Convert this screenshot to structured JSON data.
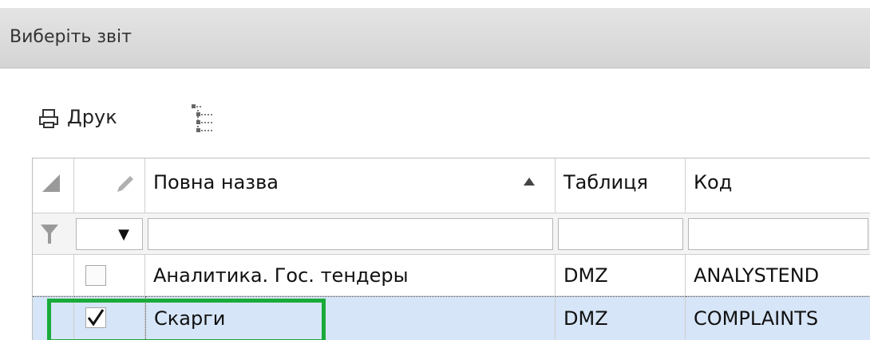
{
  "header": {
    "title": "Виберіть звіт"
  },
  "toolbar": {
    "print_label": "Друк"
  },
  "grid": {
    "columns": [
      {
        "label": "Повна назва",
        "sort": "ascending"
      },
      {
        "label": "Таблиця"
      },
      {
        "label": "Код"
      }
    ],
    "filter": {
      "dropdown_glyph": "▼",
      "name_value": "",
      "table_value": "",
      "code_value": ""
    },
    "rows": [
      {
        "checked": false,
        "name": "Аналитика. Гос. тендеры",
        "table": "DMZ",
        "code": "ANALYSTEND"
      },
      {
        "checked": true,
        "name": "Скарги",
        "table": "DMZ",
        "code": "COMPLAINTS"
      }
    ]
  },
  "colors": {
    "highlight": "#1aaa3a",
    "selected_row": "#d6e5f7",
    "header_bg": "#d9d9d9"
  }
}
